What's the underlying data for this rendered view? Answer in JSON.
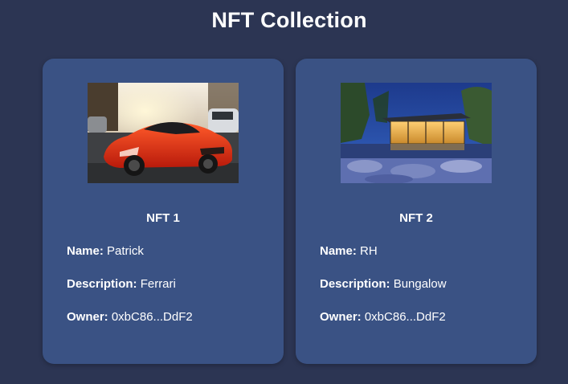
{
  "page": {
    "title": "NFT Collection"
  },
  "colors": {
    "background": "#2c3553",
    "card": "#3a5284",
    "text": "#ffffff"
  },
  "nfts": [
    {
      "title": "NFT 1",
      "image": "red-sports-car-photo",
      "name_label": "Name:",
      "name": "Patrick",
      "description_label": "Description:",
      "description": "Ferrari",
      "owner_label": "Owner:",
      "owner": "0xbC86...DdF2"
    },
    {
      "title": "NFT 2",
      "image": "modern-bungalow-night-photo",
      "name_label": "Name:",
      "name": "RH",
      "description_label": "Description:",
      "description": "Bungalow",
      "owner_label": "Owner:",
      "owner": "0xbC86...DdF2"
    }
  ]
}
